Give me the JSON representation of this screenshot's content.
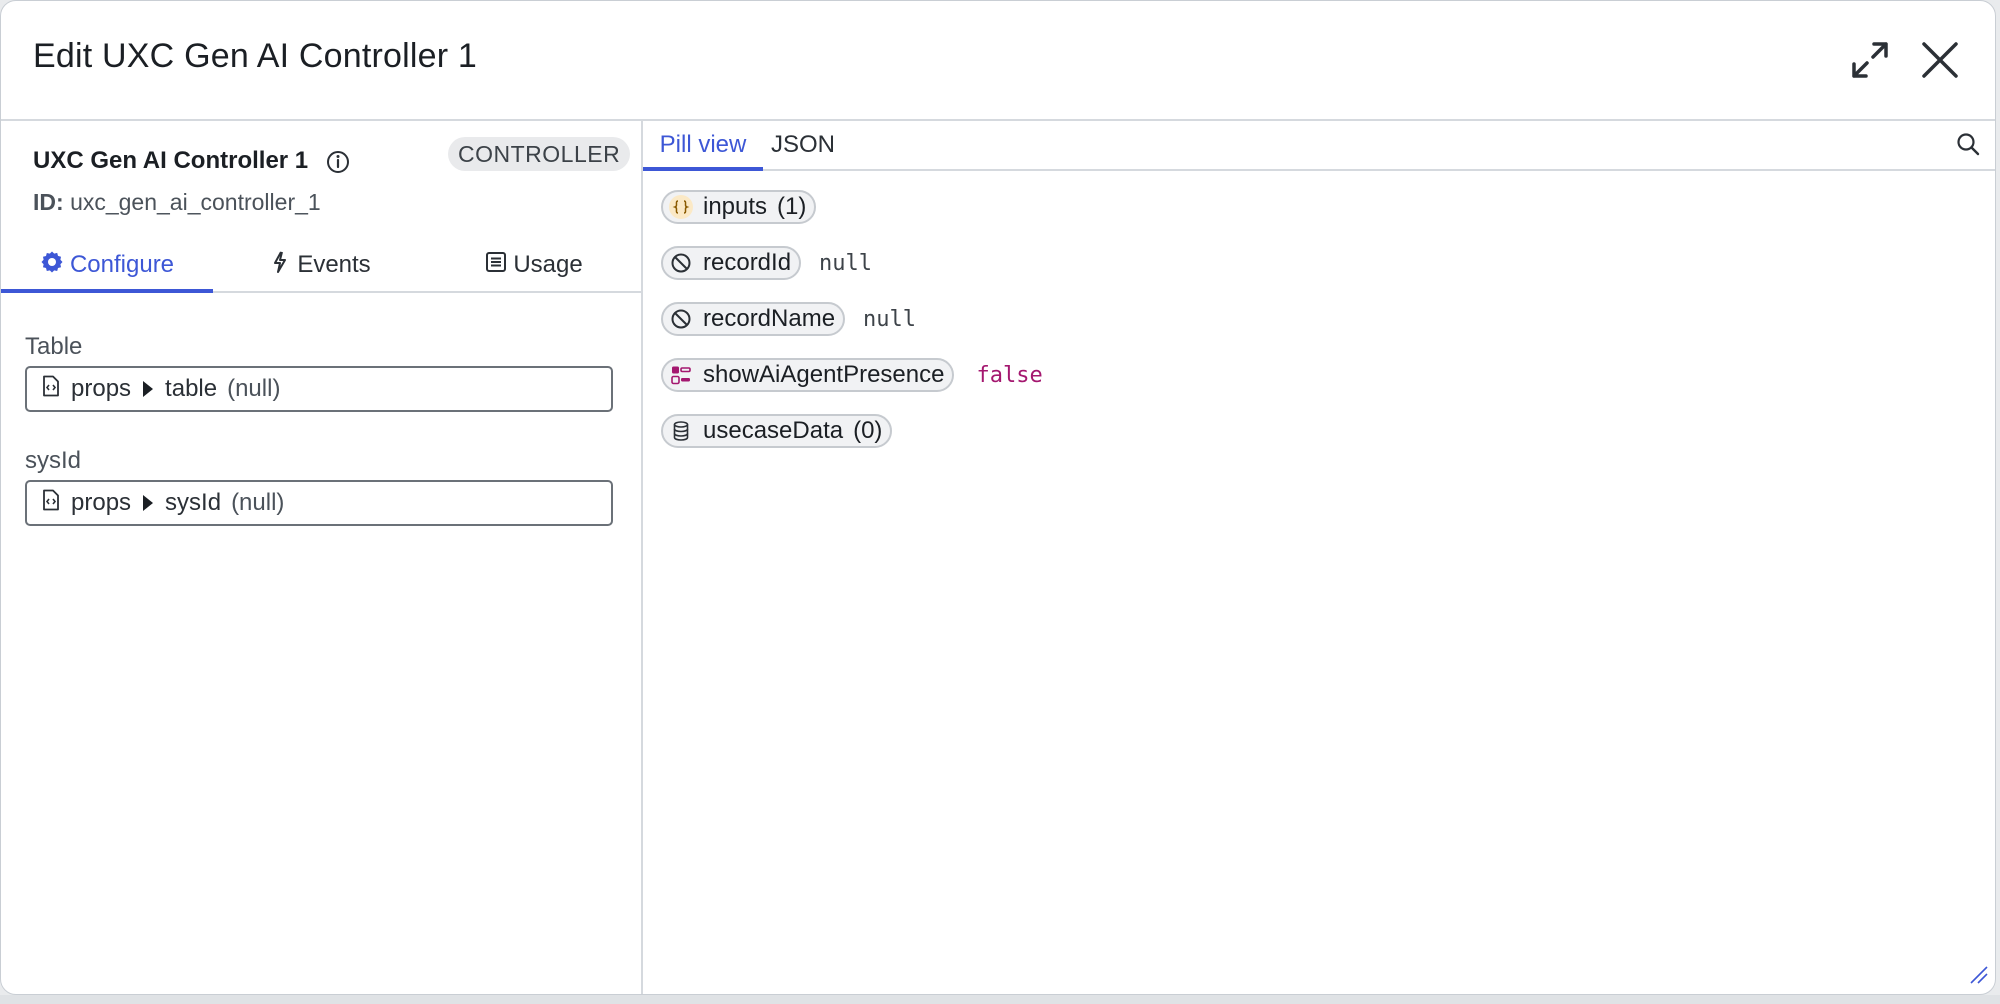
{
  "header": {
    "title": "Edit UXC Gen AI Controller 1",
    "expand_icon": "expand-icon",
    "close_icon": "close-icon"
  },
  "component": {
    "name": "UXC Gen AI Controller 1",
    "badge": "CONTROLLER",
    "id_label": "ID:",
    "id_value": "uxc_gen_ai_controller_1"
  },
  "left_tabs": [
    {
      "label": "Configure",
      "icon": "gear-icon",
      "active": true
    },
    {
      "label": "Events",
      "icon": "lightning-icon",
      "active": false
    },
    {
      "label": "Usage",
      "icon": "list-icon",
      "active": false
    }
  ],
  "fields": [
    {
      "label": "Table",
      "path_root": "props",
      "path_key": "table",
      "value": "(null)"
    },
    {
      "label": "sysId",
      "path_root": "props",
      "path_key": "sysId",
      "value": "(null)"
    }
  ],
  "right_tabs": [
    {
      "label": "Pill view",
      "active": true
    },
    {
      "label": "JSON",
      "active": false
    }
  ],
  "pills": [
    {
      "label": "inputs",
      "count": "(1)",
      "icon": "object-braces-icon",
      "value": ""
    },
    {
      "label": "recordId",
      "count": "",
      "icon": "null-icon",
      "value": "null"
    },
    {
      "label": "recordName",
      "count": "",
      "icon": "null-icon",
      "value": "null"
    },
    {
      "label": "showAiAgentPresence",
      "count": "",
      "icon": "boolean-toggle-icon",
      "value": "false"
    },
    {
      "label": "usecaseData",
      "count": "(0)",
      "icon": "database-icon",
      "value": ""
    }
  ],
  "colors": {
    "accent": "#3d57d6",
    "boolean_value": "#a4176f"
  }
}
